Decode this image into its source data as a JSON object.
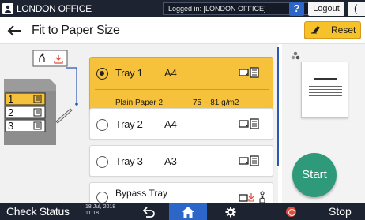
{
  "topbar": {
    "office": "LONDON OFFICE",
    "login_status": "Logged in: [LONDON OFFICE]",
    "help_label": "?",
    "logout_label": "Logout",
    "more_label": "("
  },
  "header": {
    "title": "Fit to Paper Size",
    "reset_label": "Reset"
  },
  "machine": {
    "tray_numbers": [
      "1",
      "2",
      "3"
    ]
  },
  "trays": [
    {
      "name": "Tray 1",
      "size": "A4",
      "selected": true,
      "paper_type": "Plain Paper 2",
      "weight": "75 – 81 g/m2"
    },
    {
      "name": "Tray 2",
      "size": "A4",
      "selected": false
    },
    {
      "name": "Tray 3",
      "size": "A3",
      "selected": false
    },
    {
      "name": "Bypass Tray",
      "size": "",
      "selected": false
    }
  ],
  "start_label": "Start",
  "bottombar": {
    "check_status": "Check Status",
    "date": "18 Jul, 2018",
    "time": "11:18",
    "stop_label": "Stop"
  },
  "colors": {
    "accent_yellow": "#f7c23b",
    "start_green": "#2f9a79",
    "bar_dark": "#1d2331",
    "home_blue": "#2b66c8",
    "stop_red": "#e24a3b"
  }
}
